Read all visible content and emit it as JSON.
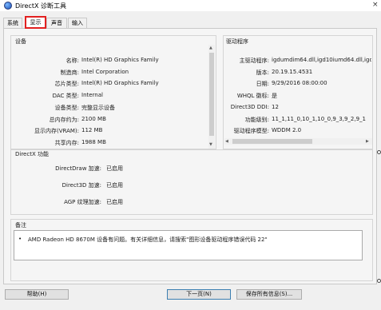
{
  "window": {
    "title": "DirectX 诊断工具",
    "close_glyph": "×"
  },
  "tabs": [
    {
      "label": "系统"
    },
    {
      "label": "显示",
      "selected": true
    },
    {
      "label": "声音"
    },
    {
      "label": "输入"
    }
  ],
  "device": {
    "section_title": "设备",
    "rows": [
      {
        "label": "名称:",
        "value": "Intel(R) HD Graphics Family"
      },
      {
        "label": "制造商:",
        "value": "Intel Corporation"
      },
      {
        "label": "芯片类型:",
        "value": "Intel(R) HD Graphics Family"
      },
      {
        "label": "DAC 类型:",
        "value": "Internal"
      },
      {
        "label": "设备类型:",
        "value": "完整显示设备"
      },
      {
        "label": "总内存约为:",
        "value": "2100 MB"
      },
      {
        "label": "显示内存(VRAM):",
        "value": "112 MB"
      },
      {
        "label": "共享内存:",
        "value": "1988 MB"
      }
    ]
  },
  "driver": {
    "section_title": "驱动程序",
    "rows": [
      {
        "label": "主驱动程序:",
        "value": "igdumdim64.dll,igd10iumd64.dll,igd1"
      },
      {
        "label": "版本:",
        "value": "20.19.15.4531"
      },
      {
        "label": "日期:",
        "value": "9/29/2016 08:00:00"
      },
      {
        "label": "WHQL 徽标:",
        "value": "是"
      },
      {
        "label": "Direct3D DDI:",
        "value": "12"
      },
      {
        "label": "功能级别:",
        "value": "11_1,11_0,10_1,10_0,9_3,9_2,9_1"
      },
      {
        "label": "驱动程序模型:",
        "value": "WDDM 2.0"
      }
    ]
  },
  "directx_features": {
    "section_title": "DirectX 功能",
    "rows": [
      {
        "label": "DirectDraw 加速:",
        "value": "已启用"
      },
      {
        "label": "Direct3D 加速:",
        "value": "已启用"
      },
      {
        "label": "AGP 纹理加速:",
        "value": "已启用"
      }
    ]
  },
  "notes": {
    "section_title": "备注",
    "bullet": "•",
    "items": [
      {
        "text": "AMD Radeon HD 8670M 设备有问题。有关详细信息，请搜索\"图形设备驱动程序错误代码 22\""
      }
    ]
  },
  "buttons": {
    "help": "帮助(H)",
    "next": "下一页(N)",
    "save": "保存所有信息(S)..."
  },
  "colors": {
    "selected_tab_highlight": "#e22020",
    "panel_bg": "#f5f5f5",
    "button_bg": "#e1e1e1"
  },
  "icons": {
    "app": "directx-globe-icon",
    "close": "close-icon",
    "scroll_up": "triangle-up-icon",
    "scroll_down": "triangle-down-icon",
    "scroll_left": "triangle-left-icon",
    "scroll_right": "triangle-right-icon"
  }
}
